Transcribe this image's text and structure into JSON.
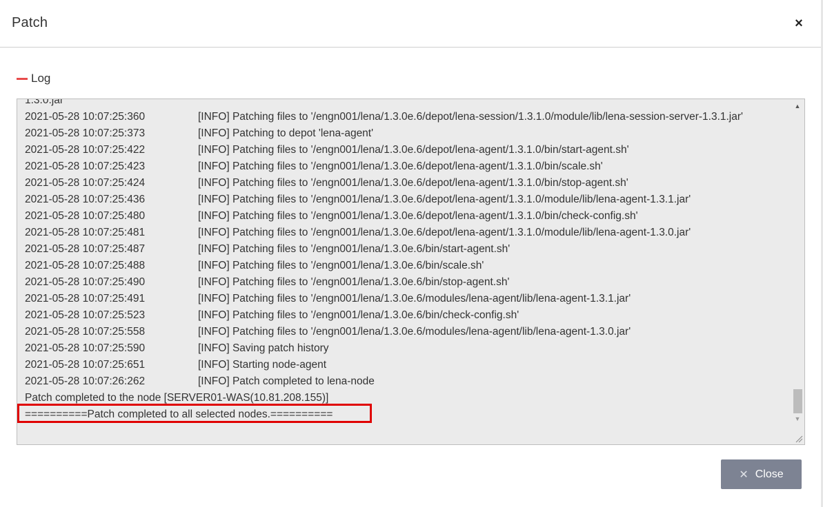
{
  "dialog": {
    "title": "Patch",
    "close_icon": "×"
  },
  "section": {
    "label": "Log"
  },
  "log": {
    "partial_top_line": "1.3.0.jar'",
    "entries": [
      {
        "time": "2021-05-28 10:07:25:360",
        "msg": "[INFO] Patching files to '/engn001/lena/1.3.0e.6/depot/lena-session/1.3.1.0/module/lib/lena-session-server-1.3.1.jar'"
      },
      {
        "time": "2021-05-28 10:07:25:373",
        "msg": "[INFO] Patching to depot 'lena-agent'"
      },
      {
        "time": "2021-05-28 10:07:25:422",
        "msg": "[INFO] Patching files to '/engn001/lena/1.3.0e.6/depot/lena-agent/1.3.1.0/bin/start-agent.sh'"
      },
      {
        "time": "2021-05-28 10:07:25:423",
        "msg": "[INFO] Patching files to '/engn001/lena/1.3.0e.6/depot/lena-agent/1.3.1.0/bin/scale.sh'"
      },
      {
        "time": "2021-05-28 10:07:25:424",
        "msg": "[INFO] Patching files to '/engn001/lena/1.3.0e.6/depot/lena-agent/1.3.1.0/bin/stop-agent.sh'"
      },
      {
        "time": "2021-05-28 10:07:25:436",
        "msg": "[INFO] Patching files to '/engn001/lena/1.3.0e.6/depot/lena-agent/1.3.1.0/module/lib/lena-agent-1.3.1.jar'"
      },
      {
        "time": "2021-05-28 10:07:25:480",
        "msg": "[INFO] Patching files to '/engn001/lena/1.3.0e.6/depot/lena-agent/1.3.1.0/bin/check-config.sh'"
      },
      {
        "time": "2021-05-28 10:07:25:481",
        "msg": "[INFO] Patching files to '/engn001/lena/1.3.0e.6/depot/lena-agent/1.3.1.0/module/lib/lena-agent-1.3.0.jar'"
      },
      {
        "time": "2021-05-28 10:07:25:487",
        "msg": "[INFO] Patching files to '/engn001/lena/1.3.0e.6/bin/start-agent.sh'"
      },
      {
        "time": "2021-05-28 10:07:25:488",
        "msg": "[INFO] Patching files to '/engn001/lena/1.3.0e.6/bin/scale.sh'"
      },
      {
        "time": "2021-05-28 10:07:25:490",
        "msg": "[INFO] Patching files to '/engn001/lena/1.3.0e.6/bin/stop-agent.sh'"
      },
      {
        "time": "2021-05-28 10:07:25:491",
        "msg": "[INFO] Patching files to '/engn001/lena/1.3.0e.6/modules/lena-agent/lib/lena-agent-1.3.1.jar'"
      },
      {
        "time": "2021-05-28 10:07:25:523",
        "msg": "[INFO] Patching files to '/engn001/lena/1.3.0e.6/bin/check-config.sh'"
      },
      {
        "time": "2021-05-28 10:07:25:558",
        "msg": "[INFO] Patching files to '/engn001/lena/1.3.0e.6/modules/lena-agent/lib/lena-agent-1.3.0.jar'"
      },
      {
        "time": "2021-05-28 10:07:25:590",
        "msg": "[INFO] Saving patch history"
      },
      {
        "time": "2021-05-28 10:07:25:651",
        "msg": "[INFO] Starting node-agent"
      },
      {
        "time": "2021-05-28 10:07:26:262",
        "msg": "[INFO] Patch completed to lena-node"
      }
    ],
    "node_completed_line": "Patch completed to the node [SERVER01-WAS(10.81.208.155)]",
    "all_completed_line": "==========Patch completed to all selected nodes.=========="
  },
  "footer": {
    "close_button_label": "Close",
    "close_button_icon": "✕"
  },
  "colors": {
    "accent_red": "#e84b4b",
    "highlight_red": "#e00000",
    "button_bg": "#7d8393",
    "log_bg": "#ebebeb"
  }
}
